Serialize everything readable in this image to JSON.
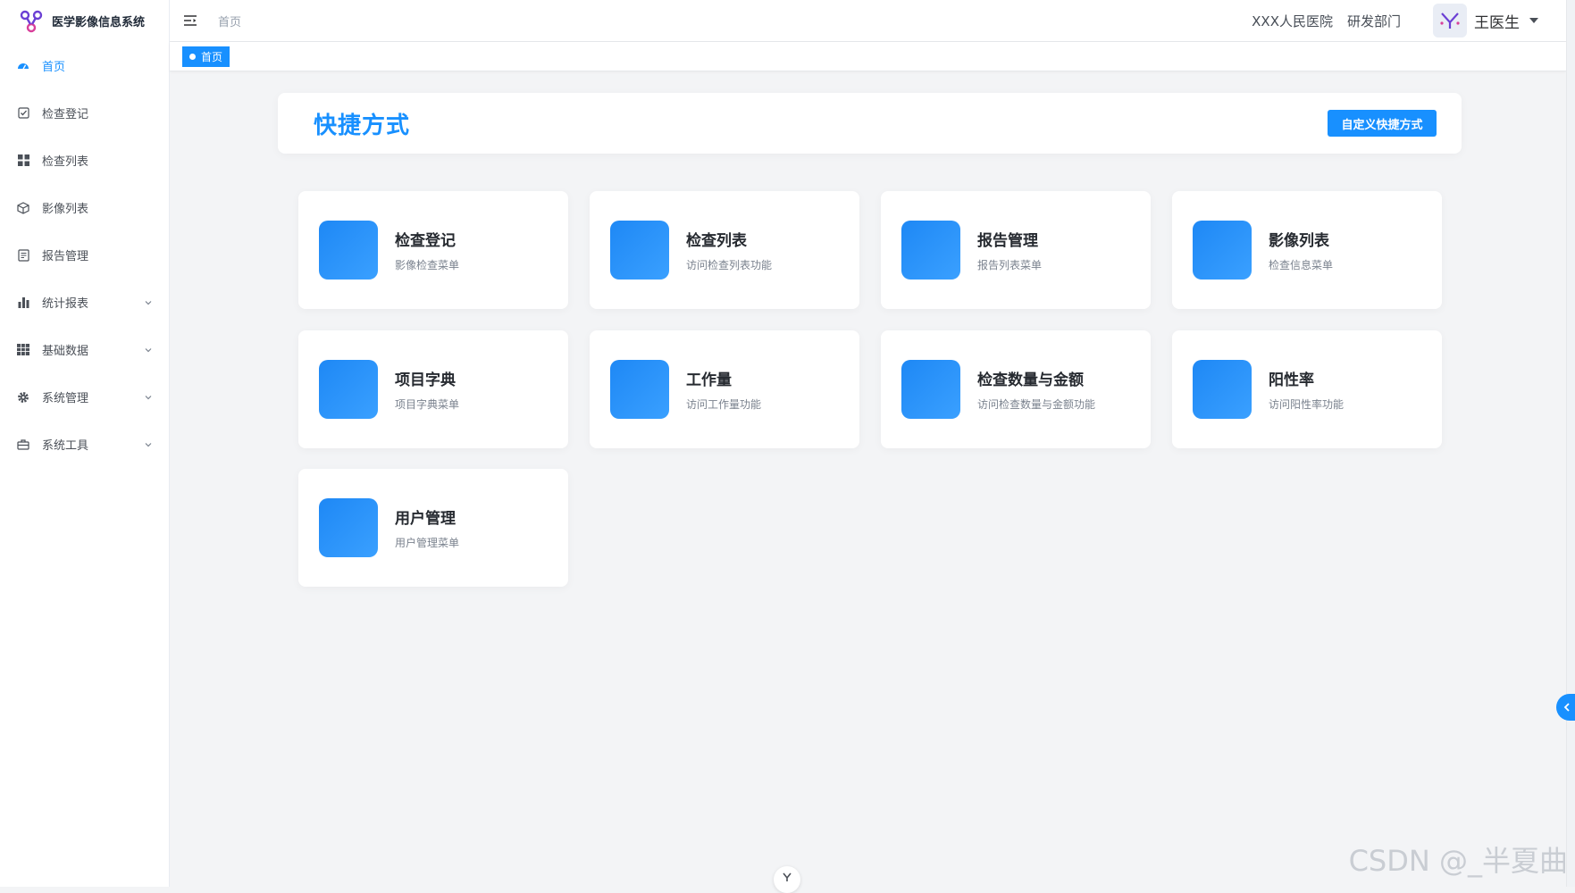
{
  "app": {
    "title": "医学影像信息系统",
    "logo_icon": "molecule-logo-icon",
    "accent_color": "#1890ff"
  },
  "sidebar": {
    "items": [
      {
        "label": "首页",
        "icon": "dashboard-icon",
        "active": true,
        "expandable": false
      },
      {
        "label": "检查登记",
        "icon": "checkbox-icon",
        "active": false,
        "expandable": false
      },
      {
        "label": "检查列表",
        "icon": "grid-icon",
        "active": false,
        "expandable": false
      },
      {
        "label": "影像列表",
        "icon": "cube-icon",
        "active": false,
        "expandable": false
      },
      {
        "label": "报告管理",
        "icon": "report-icon",
        "active": false,
        "expandable": false
      },
      {
        "label": "统计报表",
        "icon": "bar-chart-icon",
        "active": false,
        "expandable": true
      },
      {
        "label": "基础数据",
        "icon": "table-icon",
        "active": false,
        "expandable": true
      },
      {
        "label": "系统管理",
        "icon": "gear-icon",
        "active": false,
        "expandable": true
      },
      {
        "label": "系统工具",
        "icon": "toolbox-icon",
        "active": false,
        "expandable": true
      }
    ]
  },
  "header": {
    "breadcrumb": "首页",
    "hospital": "XXX人民医院",
    "department": "研发部门",
    "user_name": "王医生"
  },
  "tags": {
    "active_tag": "首页"
  },
  "shortcut_panel": {
    "title": "快捷方式",
    "customize_button": "自定义快捷方式"
  },
  "cards": [
    {
      "title": "检查登记",
      "desc": "影像检查菜单"
    },
    {
      "title": "检查列表",
      "desc": "访问检查列表功能"
    },
    {
      "title": "报告管理",
      "desc": "报告列表菜单"
    },
    {
      "title": "影像列表",
      "desc": "检查信息菜单"
    },
    {
      "title": "项目字典",
      "desc": "项目字典菜单"
    },
    {
      "title": "工作量",
      "desc": "访问工作量功能"
    },
    {
      "title": "检查数量与金额",
      "desc": "访问检查数量与金额功能"
    },
    {
      "title": "阳性率",
      "desc": "访问阳性率功能"
    },
    {
      "title": "用户管理",
      "desc": "用户管理菜单"
    }
  ],
  "watermark": "CSDN @_半夏曲"
}
